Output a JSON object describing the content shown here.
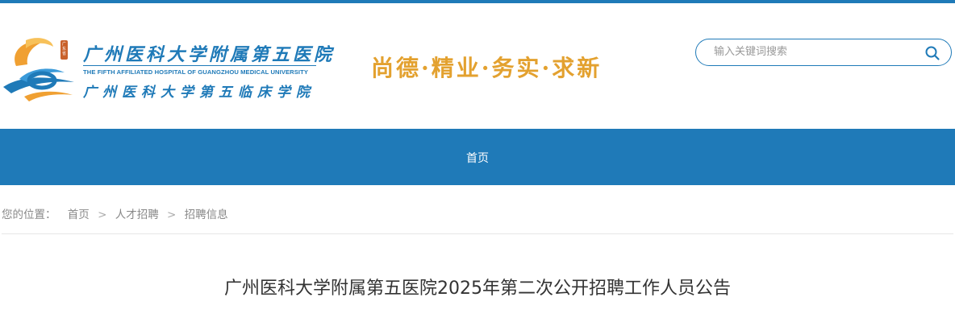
{
  "header": {
    "logo": {
      "name_cn": "广州医科大学附属第五医院",
      "name_en": "THE FIFTH AFFILIATED HOSPITAL OF GUANGZHOU MEDICAL UNIVERSITY",
      "name_cn2": "广州医科大学第五临床学院",
      "seal_text": "广东省"
    },
    "slogan": "尚德·精业·务实·求新",
    "search": {
      "placeholder": "输入关键词搜索",
      "value": ""
    }
  },
  "nav": {
    "items": [
      {
        "label": "首页"
      }
    ]
  },
  "breadcrumb": {
    "prefix": "您的位置：",
    "separator": ">",
    "items": [
      "首页",
      "人才招聘",
      "招聘信息"
    ]
  },
  "article": {
    "title": "广州医科大学附属第五医院2025年第二次公开招聘工作人员公告"
  },
  "colors": {
    "primary_blue": "#1f7ab8",
    "slogan_gold": "#e3a12f",
    "logo_orange": "#f0a032"
  }
}
